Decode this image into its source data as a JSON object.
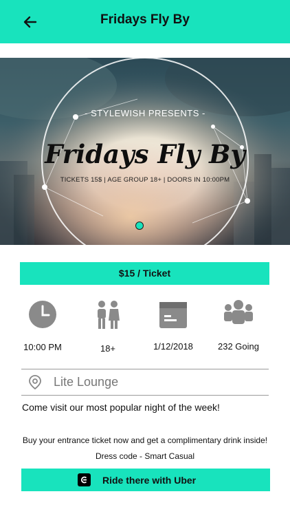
{
  "header": {
    "title": "Fridays Fly By",
    "back_icon": "arrow-left-icon"
  },
  "hero": {
    "presents": "- STYLEWISH PRESENTS -",
    "event_name": "Fridays Fly By",
    "info_line": "TICKETS 15$  |  AGE GROUP 18+  |  DOORS IN 10:00PM",
    "page_indicator": 1
  },
  "price": {
    "label": "$15 / Ticket"
  },
  "details": [
    {
      "icon": "clock-icon",
      "label": "10:00 PM"
    },
    {
      "icon": "people-icon",
      "label": "18+"
    },
    {
      "icon": "calendar-icon",
      "label": "1/12/2018"
    },
    {
      "icon": "group-icon",
      "label": "232 Going"
    }
  ],
  "location": {
    "icon": "location-pin-icon",
    "name": "Lite Lounge"
  },
  "description": {
    "line1": "Come visit our most popular night of the week!",
    "line2": "Buy your entrance ticket now and get a complimentary drink inside!",
    "line3": "Dress code - Smart Casual"
  },
  "uber": {
    "label": "Ride there with Uber",
    "icon": "uber-icon"
  },
  "colors": {
    "accent": "#18e3bd",
    "icon_gray": "#8a8a8a"
  }
}
